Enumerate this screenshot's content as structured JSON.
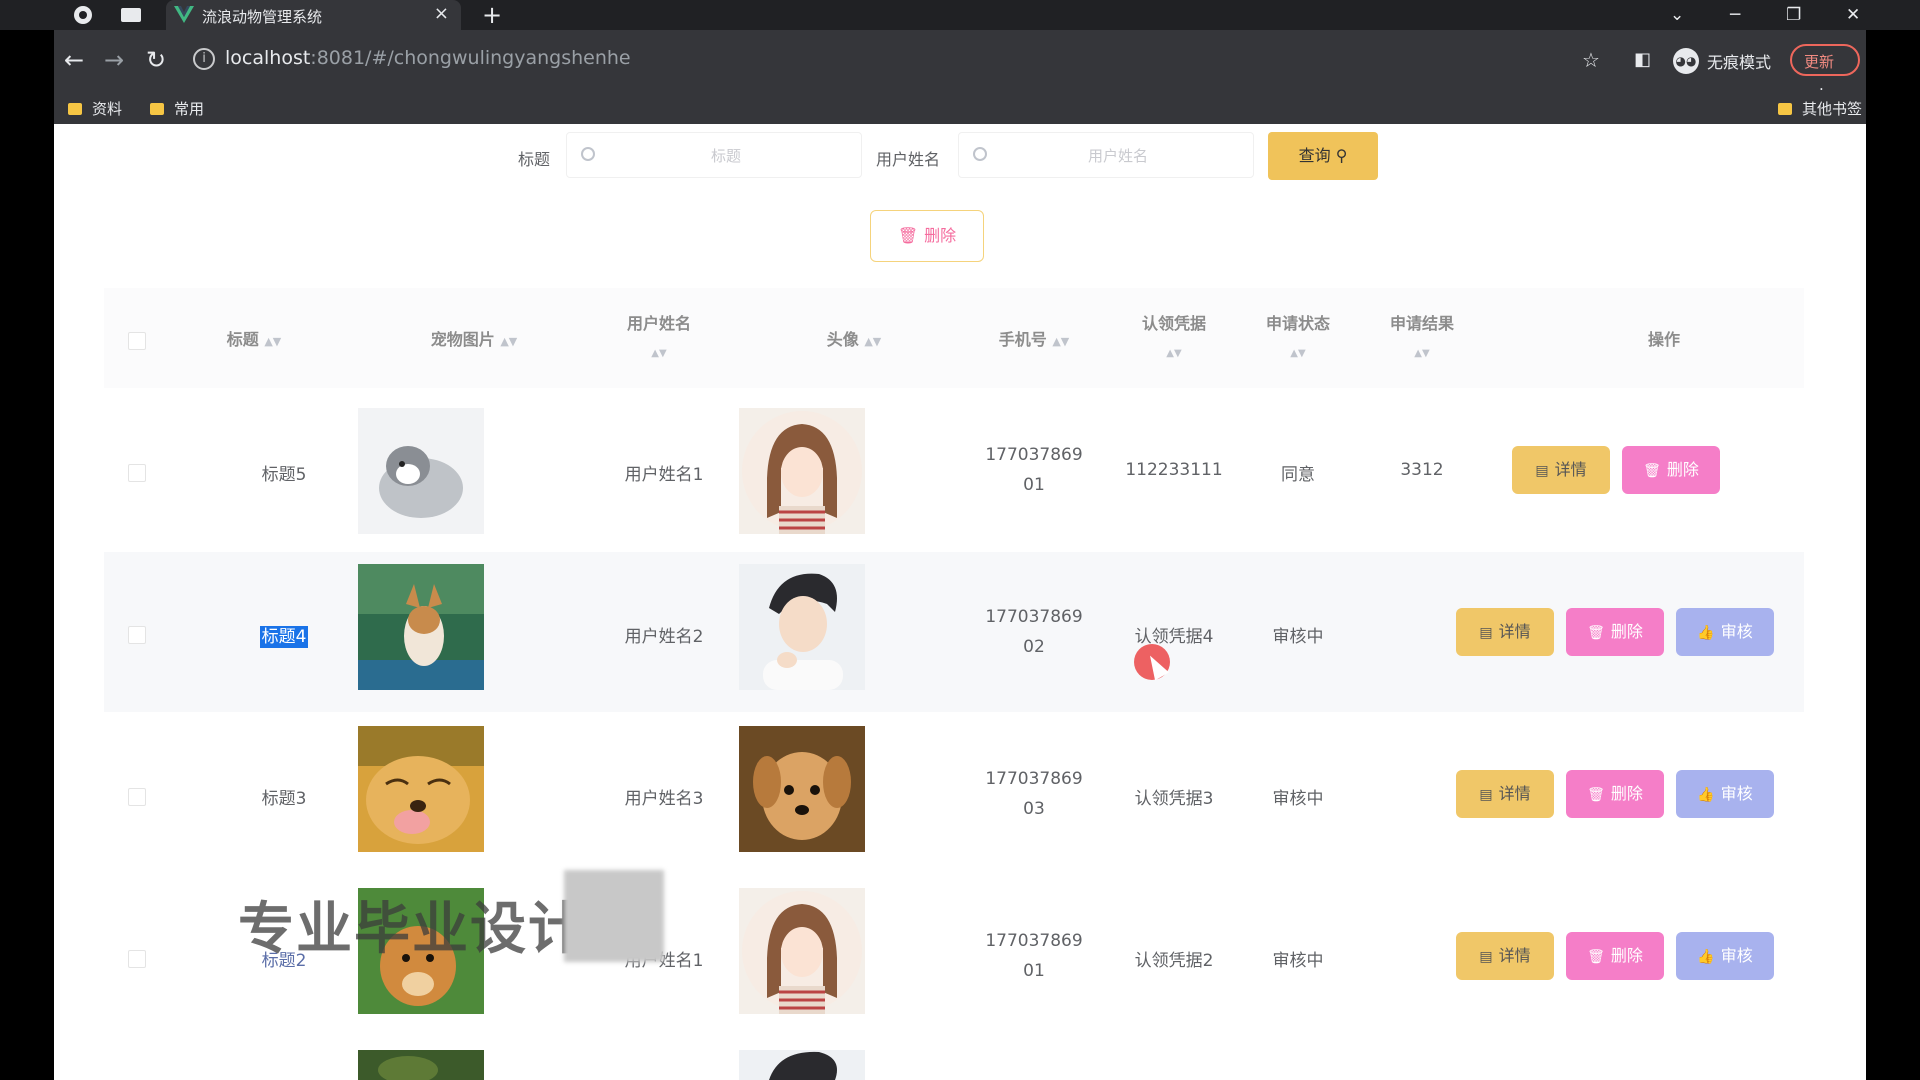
{
  "browser": {
    "tab_title": "流浪动物管理系统",
    "url_host": "localhost",
    "url_rest": ":8081/#/chongwulingyangshenhe",
    "incognito_label": "无痕模式",
    "update_label": "更新",
    "bookmarks": [
      "资料",
      "常用"
    ],
    "other_bookmarks": "其他书签"
  },
  "search": {
    "title_label": "标题",
    "title_placeholder": "标题",
    "username_label": "用户姓名",
    "username_placeholder": "用户姓名",
    "query_button": "查询"
  },
  "toolbar": {
    "delete_button": "删除"
  },
  "table": {
    "headers": {
      "title": "标题",
      "pet_image": "宠物图片",
      "username": "用户姓名",
      "avatar": "头像",
      "phone": "手机号",
      "proof": "认领凭据",
      "status": "申请状态",
      "result": "申请结果",
      "actions": "操作"
    },
    "rows": [
      {
        "title": "标题5",
        "username": "用户姓名1",
        "phone_a": "177037869",
        "phone_b": "01",
        "proof": "112233111",
        "status": "同意",
        "result": "3312"
      },
      {
        "title": "标题4",
        "username": "用户姓名2",
        "phone_a": "177037869",
        "phone_b": "02",
        "proof": "认领凭据4",
        "status": "审核中",
        "result": ""
      },
      {
        "title": "标题3",
        "username": "用户姓名3",
        "phone_a": "177037869",
        "phone_b": "03",
        "proof": "认领凭据3",
        "status": "审核中",
        "result": ""
      },
      {
        "title": "标题2",
        "username": "用户姓名1",
        "phone_a": "177037869",
        "phone_b": "01",
        "proof": "认领凭据2",
        "status": "审核中",
        "result": ""
      }
    ],
    "buttons": {
      "detail": "详情",
      "delete": "删除",
      "audit": "审核"
    }
  },
  "watermark": "专业毕业设计"
}
